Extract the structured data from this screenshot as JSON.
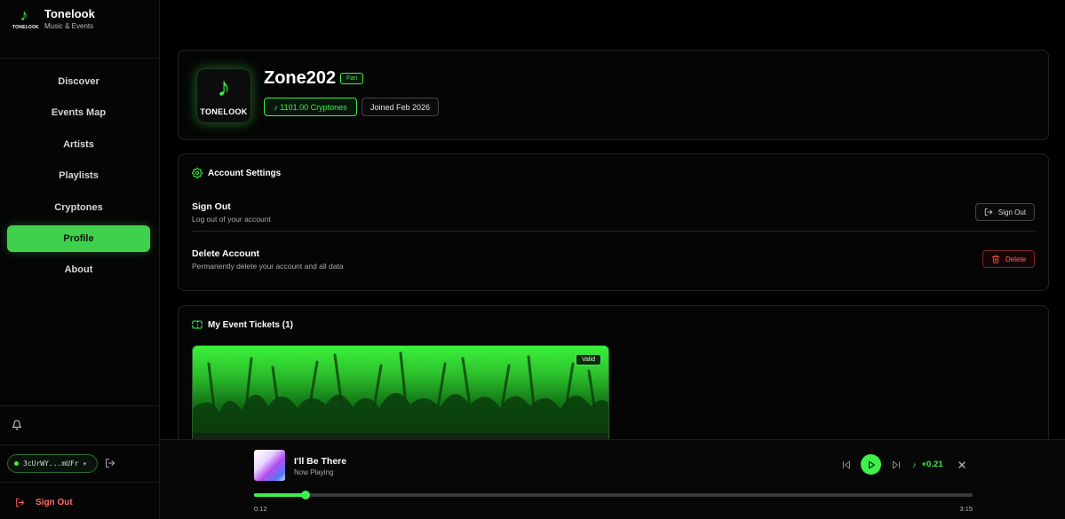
{
  "brand": {
    "name": "Tonelook",
    "subtitle": "Music & Events",
    "logo_text": "TONELOOK",
    "accent": "#3ef04a"
  },
  "nav": {
    "items": [
      {
        "label": "Discover"
      },
      {
        "label": "Events Map"
      },
      {
        "label": "Artists"
      },
      {
        "label": "Playlists"
      },
      {
        "label": "Cryptones"
      },
      {
        "label": "Profile",
        "active": true
      },
      {
        "label": "About"
      }
    ]
  },
  "sidebar_footer": {
    "wallet_address": "3cUrWY...mUFr",
    "sign_out_label": "Sign Out",
    "icons": {
      "notifications": "bell-icon",
      "disconnect": "exit-icon",
      "sign_out": "logout-icon"
    }
  },
  "profile": {
    "username": "Zone202",
    "role_badge": "Fan",
    "avatar_text": "TONELOOK",
    "cryptones": "♪ 1101.00 Cryptones",
    "joined": "Joined Feb 2026"
  },
  "settings": {
    "heading": "Account Settings",
    "sign_out": {
      "title": "Sign Out",
      "description": "Log out of your account",
      "button": "Sign Out"
    },
    "delete": {
      "title": "Delete Account",
      "description": "Permanently delete your account and all data",
      "button": "Delete"
    },
    "colors": {
      "danger": "#ff5b5b"
    }
  },
  "tickets": {
    "heading": "My Event Tickets (1)",
    "items": [
      {
        "status": "Valid"
      }
    ]
  },
  "player": {
    "title": "I'll Be There",
    "subtitle": "Now Playing",
    "reward": "+0.21",
    "current_time": "0:12",
    "duration": "3:15",
    "progress_fraction": 0.072
  }
}
